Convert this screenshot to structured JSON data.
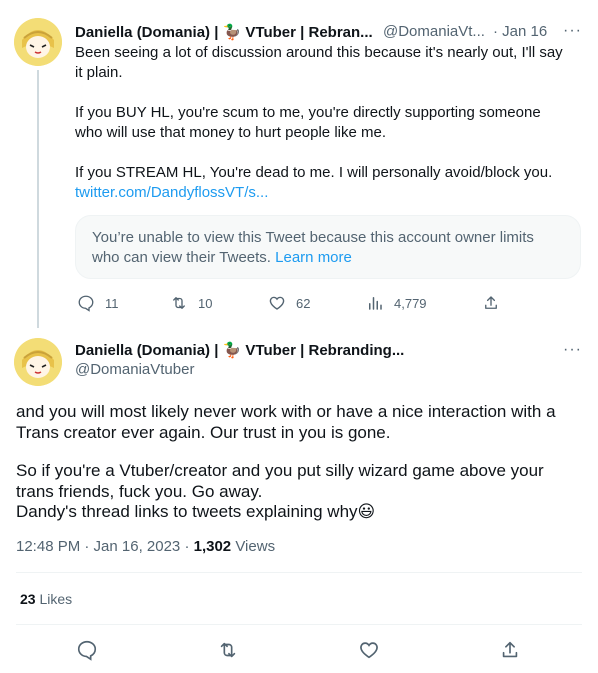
{
  "tweet1": {
    "display_name": "Daniella (Domania) | 🦆 VTuber | Rebran...",
    "handle": "@DomaniaVt...",
    "time": "· Jan 16",
    "more": "···",
    "lines": [
      "Been seeing a lot of discussion around this because it's nearly out, I'll say",
      "it plain.",
      "If you BUY HL, you're scum to me, you're directly supporting someone",
      "who will use that money to hurt people like me.",
      "If you STREAM HL, You're dead to me. I will personally avoid/block you."
    ],
    "link": "twitter.com/DandyflossVT/s...",
    "quote_line1": "You’re unable to view this Tweet because this account owner limits",
    "quote_line2": "who can view their Tweets.",
    "quote_learn_more": "Learn more",
    "actions": {
      "replies": "11",
      "retweets": "10",
      "likes": "62",
      "views": "4,779"
    }
  },
  "tweet2": {
    "display_name": "Daniella (Domania) | 🦆 VTuber | Rebranding...",
    "handle": "@DomaniaVtuber",
    "more": "···",
    "lines": [
      "and you will most likely never work with or have a nice interaction with a",
      "Trans creator ever again. Our trust in you is gone.",
      "So if you're a Vtuber/creator and you put silly wizard game above your",
      "trans friends, fuck you. Go away.",
      "Dandy's thread links to tweets explaining why😃"
    ],
    "timestamp": "12:48 PM · Jan 16, 2023 · ",
    "views_count": "1,302",
    "views_label": " Views",
    "likes_count": "23",
    "likes_label": " Likes"
  },
  "colors": {
    "link": "#1d9bf0",
    "muted": "#536471",
    "divider": "#eff3f4"
  },
  "icons": [
    "reply-icon",
    "retweet-icon",
    "like-icon",
    "views-icon",
    "share-icon"
  ]
}
